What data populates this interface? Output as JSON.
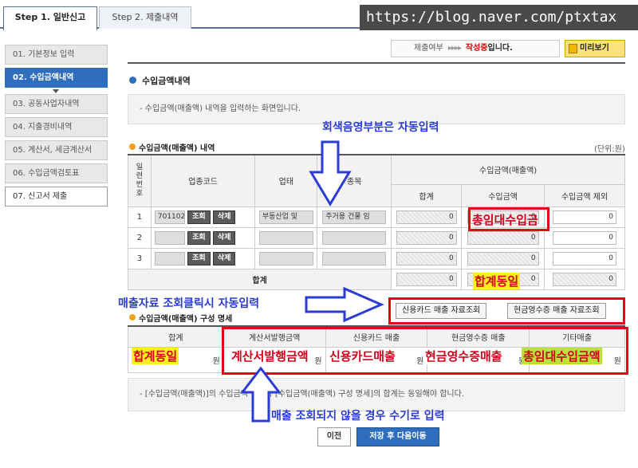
{
  "tabs": [
    "Step 1. 일반신고",
    "Step 2. 제출내역"
  ],
  "watermark": "https://blog.naver.com/ptxtax",
  "sidebar": [
    "01. 기본정보 입력",
    "02. 수입금액내역",
    "03. 공동사업자내역",
    "04. 지출경비내역",
    "05. 계산서, 세금계산서",
    "06. 수입금액검토표",
    "07. 신고서 제출"
  ],
  "status": {
    "label": "제출여부",
    "arrows": "▸▸▸▸",
    "value": "작성중",
    "suffix": "입니다."
  },
  "preview_label": "미리보기",
  "section_title": "수입금액내역",
  "info_text": "- 수입금액(매출액) 내역을 입력하는 화면입니다.",
  "table1": {
    "title": "수입금액(매출액) 내역",
    "unit": "(단위:원)",
    "headers": {
      "row_no": [
        "일",
        "련",
        "번",
        "호"
      ],
      "code": "업종코드",
      "type": "업태",
      "item": "종목",
      "income_group": "수입금액(매출액)",
      "total": "합계",
      "income": "수입금액",
      "exclude": "수입금액 제외"
    },
    "rows": [
      {
        "no": "1",
        "code": "701102",
        "type": "부동산업 및",
        "item": "주거용 건물 임",
        "total": "0",
        "income": "0",
        "exclude": "0"
      },
      {
        "no": "2",
        "code": "",
        "type": "",
        "item": "",
        "total": "0",
        "income": "0",
        "exclude": "0"
      },
      {
        "no": "3",
        "code": "",
        "type": "",
        "item": "",
        "total": "0",
        "income": "0",
        "exclude": "0"
      }
    ],
    "lookup_label": "조회",
    "delete_label": "삭제",
    "sum_label": "합계",
    "sum_values": {
      "total": "0",
      "income": "0",
      "exclude": "0"
    }
  },
  "buttons": {
    "card_lookup": "신용카드 매출 자료조회",
    "cash_lookup": "현금영수증 매출 자료조회",
    "prev": "이전",
    "next": "저장 후 다음이동"
  },
  "table2": {
    "title": "수입금액(매출액) 구성 명세",
    "headers": [
      "합계",
      "계산서발행금액",
      "신용카드 매출",
      "현금영수증 매출",
      "기타매출"
    ],
    "currency": "원"
  },
  "note_text": "- [수입금액(매출액)]의 수입금액 합계와 [수입금액(매출액) 구성 명세]의 합계는 동일해야 합니다.",
  "annotations": {
    "auto_input": "회색음영부분은 자동입력",
    "total_income": "총임대수입금",
    "sum_same_1": "합계동일",
    "lookup_auto": "매출자료 조회클릭시 자동입력",
    "sum_same_2": "합계동일",
    "invoice_amount": "계산서발행금액",
    "card_sales": "신용카드매출",
    "cash_sales": "현금영수증매출",
    "total_income_2": "총임대수입금액",
    "manual_input": "매출 조회되지 않을 경우 수기로 입력"
  },
  "colors": {
    "accent": "#2f6ebd",
    "annotation_blue": "#2b3bd6",
    "annotation_red": "#e30613",
    "highlight_yellow": "#ffef20",
    "highlight_green": "#b9e33a"
  }
}
